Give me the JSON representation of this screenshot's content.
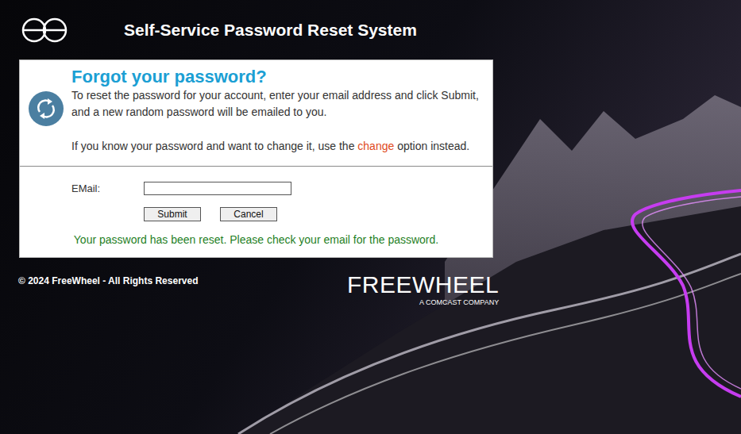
{
  "header": {
    "title": "Self-Service Password Reset System"
  },
  "form": {
    "heading": "Forgot your password?",
    "intro": [
      "To reset the password for your account, enter your email address and click Submit,",
      "and a new random password will be emailed to you."
    ],
    "hint_before": "If you know your password and want to change it, use the ",
    "hint_link": "change",
    "hint_after": " option instead.",
    "email_label": "EMail:",
    "email_value": "",
    "buttons": [
      "Submit",
      "Cancel"
    ],
    "message": "Your password has been reset. Please check your email for the password."
  },
  "footer": {
    "copyright": "© 2024 FreeWheel - All Rights Reserved",
    "brand": "FREEWHEEL",
    "tagline": "A COMCAST COMPANY"
  }
}
